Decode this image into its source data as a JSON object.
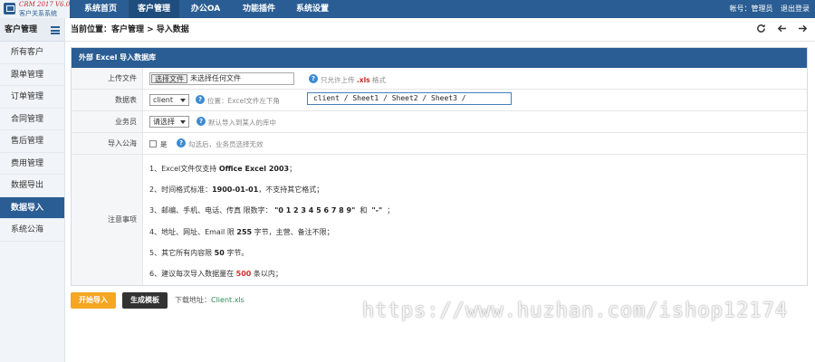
{
  "app": {
    "version": "CRM 2017 V6.0",
    "name": "客户关系系统"
  },
  "nav": {
    "tabs": [
      {
        "label": "系统首页"
      },
      {
        "label": "客户管理"
      },
      {
        "label": "办公OA"
      },
      {
        "label": "功能插件"
      },
      {
        "label": "系统设置"
      }
    ],
    "account": "帐号：管理员",
    "logout": "退出登录"
  },
  "sidebar": {
    "title": "客户管理",
    "items": [
      {
        "label": "所有客户"
      },
      {
        "label": "跟单管理"
      },
      {
        "label": "订单管理"
      },
      {
        "label": "合同管理"
      },
      {
        "label": "售后管理"
      },
      {
        "label": "费用管理"
      },
      {
        "label": "数据导出"
      },
      {
        "label": "数据导入"
      },
      {
        "label": "系统公海"
      }
    ]
  },
  "breadcrumb": "当前位置：客户管理 > 导入数据",
  "panel": {
    "title": "外部 Excel 导入数据库",
    "upload": {
      "label": "上传文件",
      "button": "选择文件",
      "status": "未选择任何文件",
      "hint_prefix": "只允许上传",
      "hint_ext": ".xls",
      "hint_suffix": "格式"
    },
    "table": {
      "label": "数据表",
      "selected": "client",
      "hint": "位置：Excel文件左下角",
      "sheets": "client / Sheet1 / Sheet2 / Sheet3 /"
    },
    "staff": {
      "label": "业务员",
      "selected": "请选择",
      "hint": "默认导入到某人的库中"
    },
    "public": {
      "label": "导入公海",
      "option": "是",
      "hint": "勾选后，业务员选择无效"
    },
    "notes": {
      "label": "注意事项",
      "n1_a": "1、Excel文件仅支持",
      "n1_b": "Office Excel 2003",
      "n1_c": "；",
      "n2_a": "2、时间格式标准：",
      "n2_b": "1900-01-01",
      "n2_c": "，不支持其它格式；",
      "n3_a": "3、邮编、手机、电话、传真 限数字：",
      "n3_b": "\"0 1 2 3 4 5 6 7 8 9\"",
      "n3_c": "和",
      "n3_d": "\"-\"",
      "n3_e": "；",
      "n4_a": "4、地址、网址、Email 限",
      "n4_b": "255",
      "n4_c": "字节，主营、备注不限；",
      "n5_a": "5、其它所有内容限",
      "n5_b": "50",
      "n5_c": "字节。",
      "n6_a": "6、建议每次导入数据量在",
      "n6_b": "500",
      "n6_c": "条以内；"
    }
  },
  "actions": {
    "start": "开始导入",
    "template": "生成模板",
    "download_label": "下载地址：",
    "download_file": "Client.xls"
  },
  "watermark": "https://www.huzhan.com/ishop12174",
  "colors": {
    "primary": "#2a5d93",
    "accent": "#f5a623",
    "danger": "#d32f2f"
  }
}
